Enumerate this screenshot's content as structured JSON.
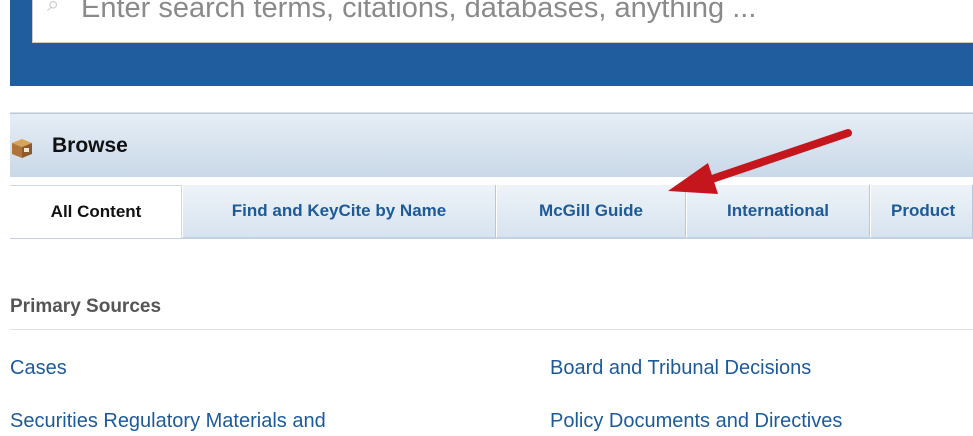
{
  "search": {
    "placeholder": "Enter search terms, citations, databases, anything ..."
  },
  "browse": {
    "title": "Browse"
  },
  "tabs": [
    {
      "label": "All Content",
      "active": true
    },
    {
      "label": "Find and KeyCite by Name",
      "active": false
    },
    {
      "label": "McGill Guide",
      "active": false
    },
    {
      "label": "International",
      "active": false
    },
    {
      "label": "Product",
      "active": false
    }
  ],
  "section": {
    "title": "Primary Sources",
    "links_left": [
      "Cases",
      "Securities Regulatory Materials and"
    ],
    "links_right": [
      "Board and Tribunal Decisions",
      "Policy Documents and Directives"
    ]
  },
  "colors": {
    "header_blue": "#1f5d9e",
    "link_blue": "#1d5a9a",
    "arrow_red": "#c4161c"
  }
}
